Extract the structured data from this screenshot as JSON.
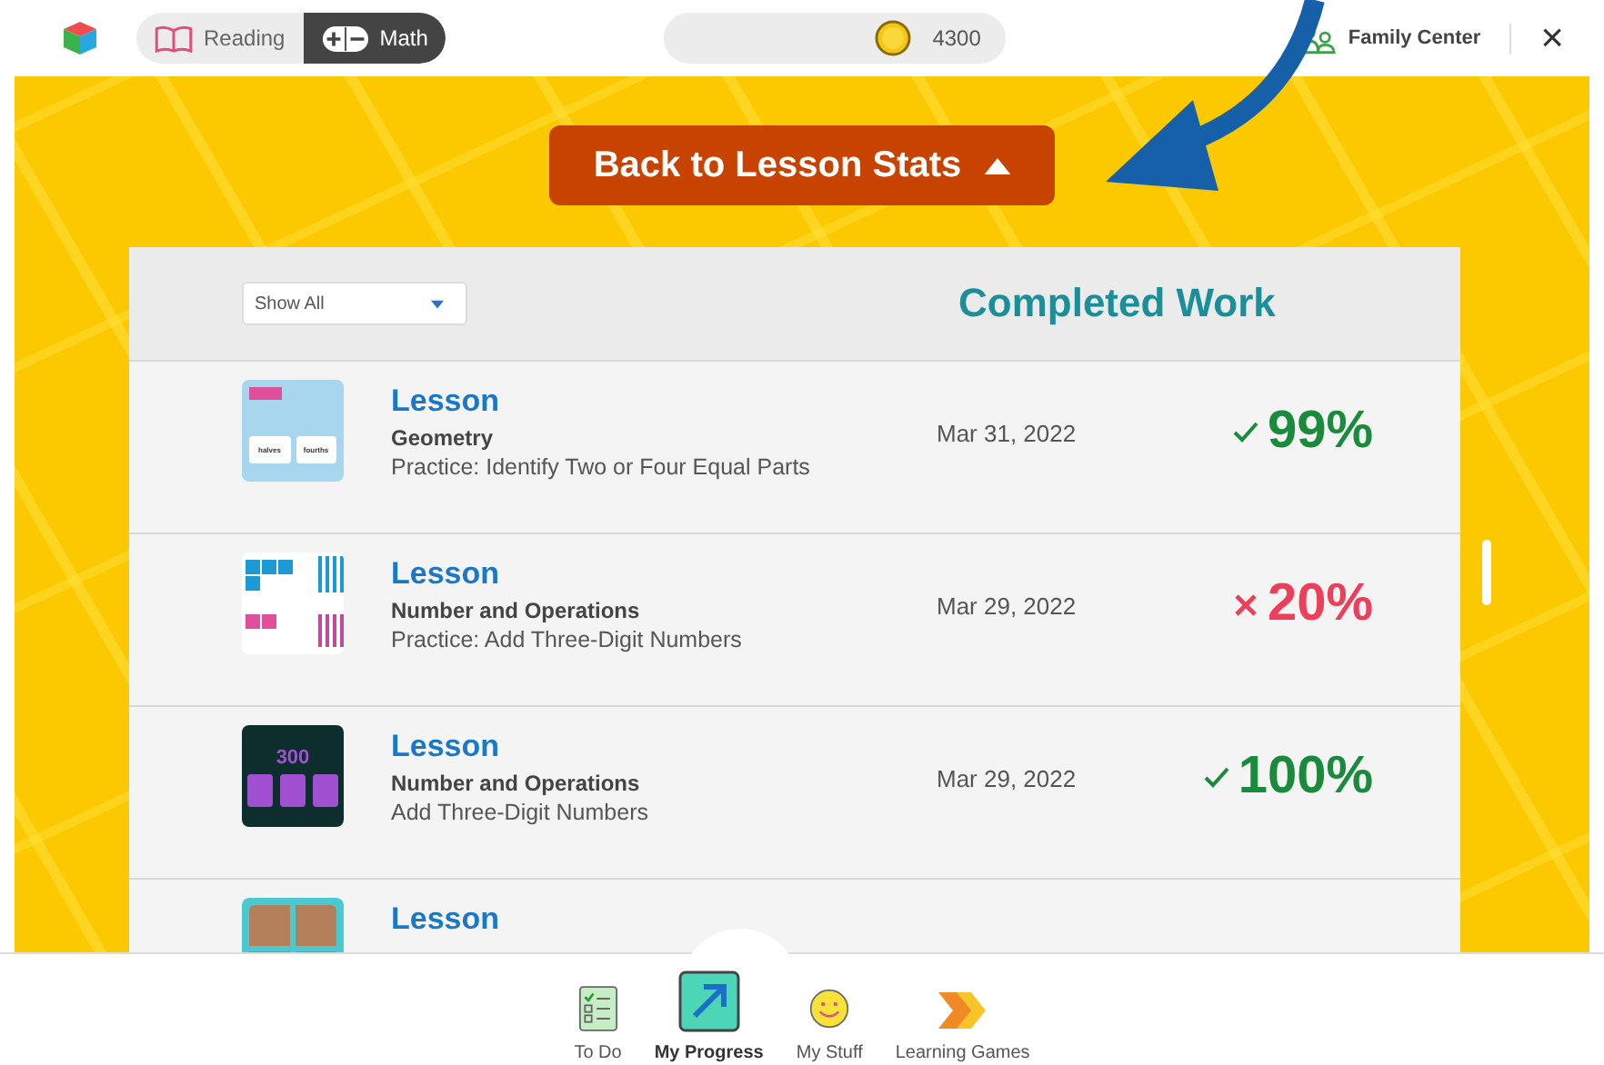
{
  "top_bar": {
    "subjects": [
      {
        "label": "Reading",
        "selected": false
      },
      {
        "label": "Math",
        "selected": true
      }
    ],
    "coins": "4300",
    "family_center": "Family Center",
    "close": "×"
  },
  "back_button": {
    "label": "Back to Lesson Stats"
  },
  "panel": {
    "filter": {
      "value": "Show All"
    },
    "title": "Completed Work",
    "rows": [
      {
        "thumbnail": {
          "kind": "cards",
          "labels": [
            "halves",
            "fourths"
          ]
        },
        "type": "Lesson",
        "subject": "Geometry",
        "name": "Practice: Identify Two or Four Equal Parts",
        "date": "Mar 31, 2022",
        "passed": true,
        "score": "99%"
      },
      {
        "thumbnail": {
          "kind": "blocks"
        },
        "type": "Lesson",
        "subject": "Number and Operations",
        "name": "Practice: Add Three-Digit Numbers",
        "date": "Mar 29, 2022",
        "passed": false,
        "score": "20%"
      },
      {
        "thumbnail": {
          "kind": "number",
          "labels": [
            "300"
          ]
        },
        "type": "Lesson",
        "subject": "Number and Operations",
        "name": "Add Three-Digit Numbers",
        "date": "Mar 29, 2022",
        "passed": true,
        "score": "100%"
      },
      {
        "thumbnail": {
          "kind": "grid"
        },
        "type": "Lesson"
      }
    ]
  },
  "bottom_nav": [
    {
      "label": "To Do",
      "selected": false
    },
    {
      "label": "My Progress",
      "selected": true
    },
    {
      "label": "My Stuff",
      "selected": false
    },
    {
      "label": "Learning Games",
      "selected": false
    }
  ]
}
